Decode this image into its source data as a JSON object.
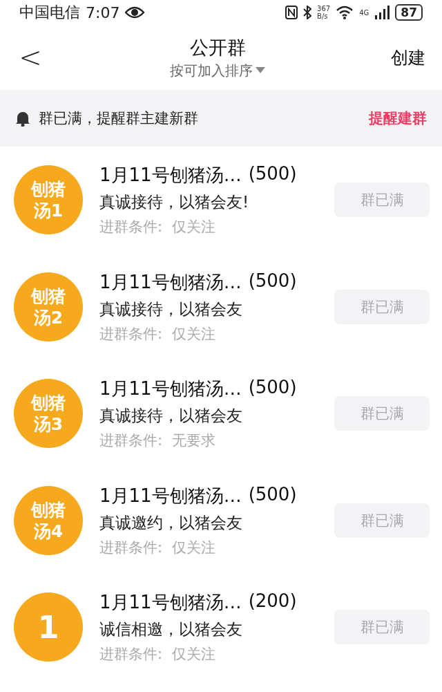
{
  "status_bar": {
    "carrier": "中国电信",
    "time": "7:07",
    "speed": [
      "367",
      "B/s"
    ],
    "network": "4G",
    "battery": "87"
  },
  "header": {
    "back": "<",
    "title": "公开群",
    "sort": "按可加入排序",
    "action": "创建"
  },
  "notice": {
    "text": "群已满，提醒群主建新群",
    "action": "提醒建群"
  },
  "groups": [
    {
      "avatar": [
        "刨猪",
        "汤1"
      ],
      "name": "1月11号刨猪汤…",
      "count": "(500)",
      "desc": "真诚接待，以猪会友!",
      "condition_label": "进群条件:",
      "condition": "仅关注",
      "button": "群已满",
      "disabled": true
    },
    {
      "avatar": [
        "刨猪",
        "汤2"
      ],
      "name": "1月11号刨猪汤…",
      "count": "(500)",
      "desc": "真诚接待，以猪会友",
      "condition_label": "进群条件:",
      "condition": "仅关注",
      "button": "群已满",
      "disabled": true
    },
    {
      "avatar": [
        "刨猪",
        "汤3"
      ],
      "name": "1月11号刨猪汤…",
      "count": "(500)",
      "desc": "真诚接待，以猪会友",
      "condition_label": "进群条件:",
      "condition": "无要求",
      "button": "群已满",
      "disabled": true
    },
    {
      "avatar": [
        "刨猪",
        "汤4"
      ],
      "name": "1月11号刨猪汤…",
      "count": "(500)",
      "desc": "真诚邀约，以猪会友",
      "condition_label": "进群条件:",
      "condition": "仅关注",
      "button": "群已满",
      "disabled": true
    },
    {
      "avatar": [
        "1"
      ],
      "name": "1月11号刨猪汤…",
      "count": "(200)",
      "desc": "诚信相邀，以猪会友",
      "condition_label": "进群条件:",
      "condition": "仅关注",
      "button": "群已满",
      "disabled": true
    }
  ]
}
